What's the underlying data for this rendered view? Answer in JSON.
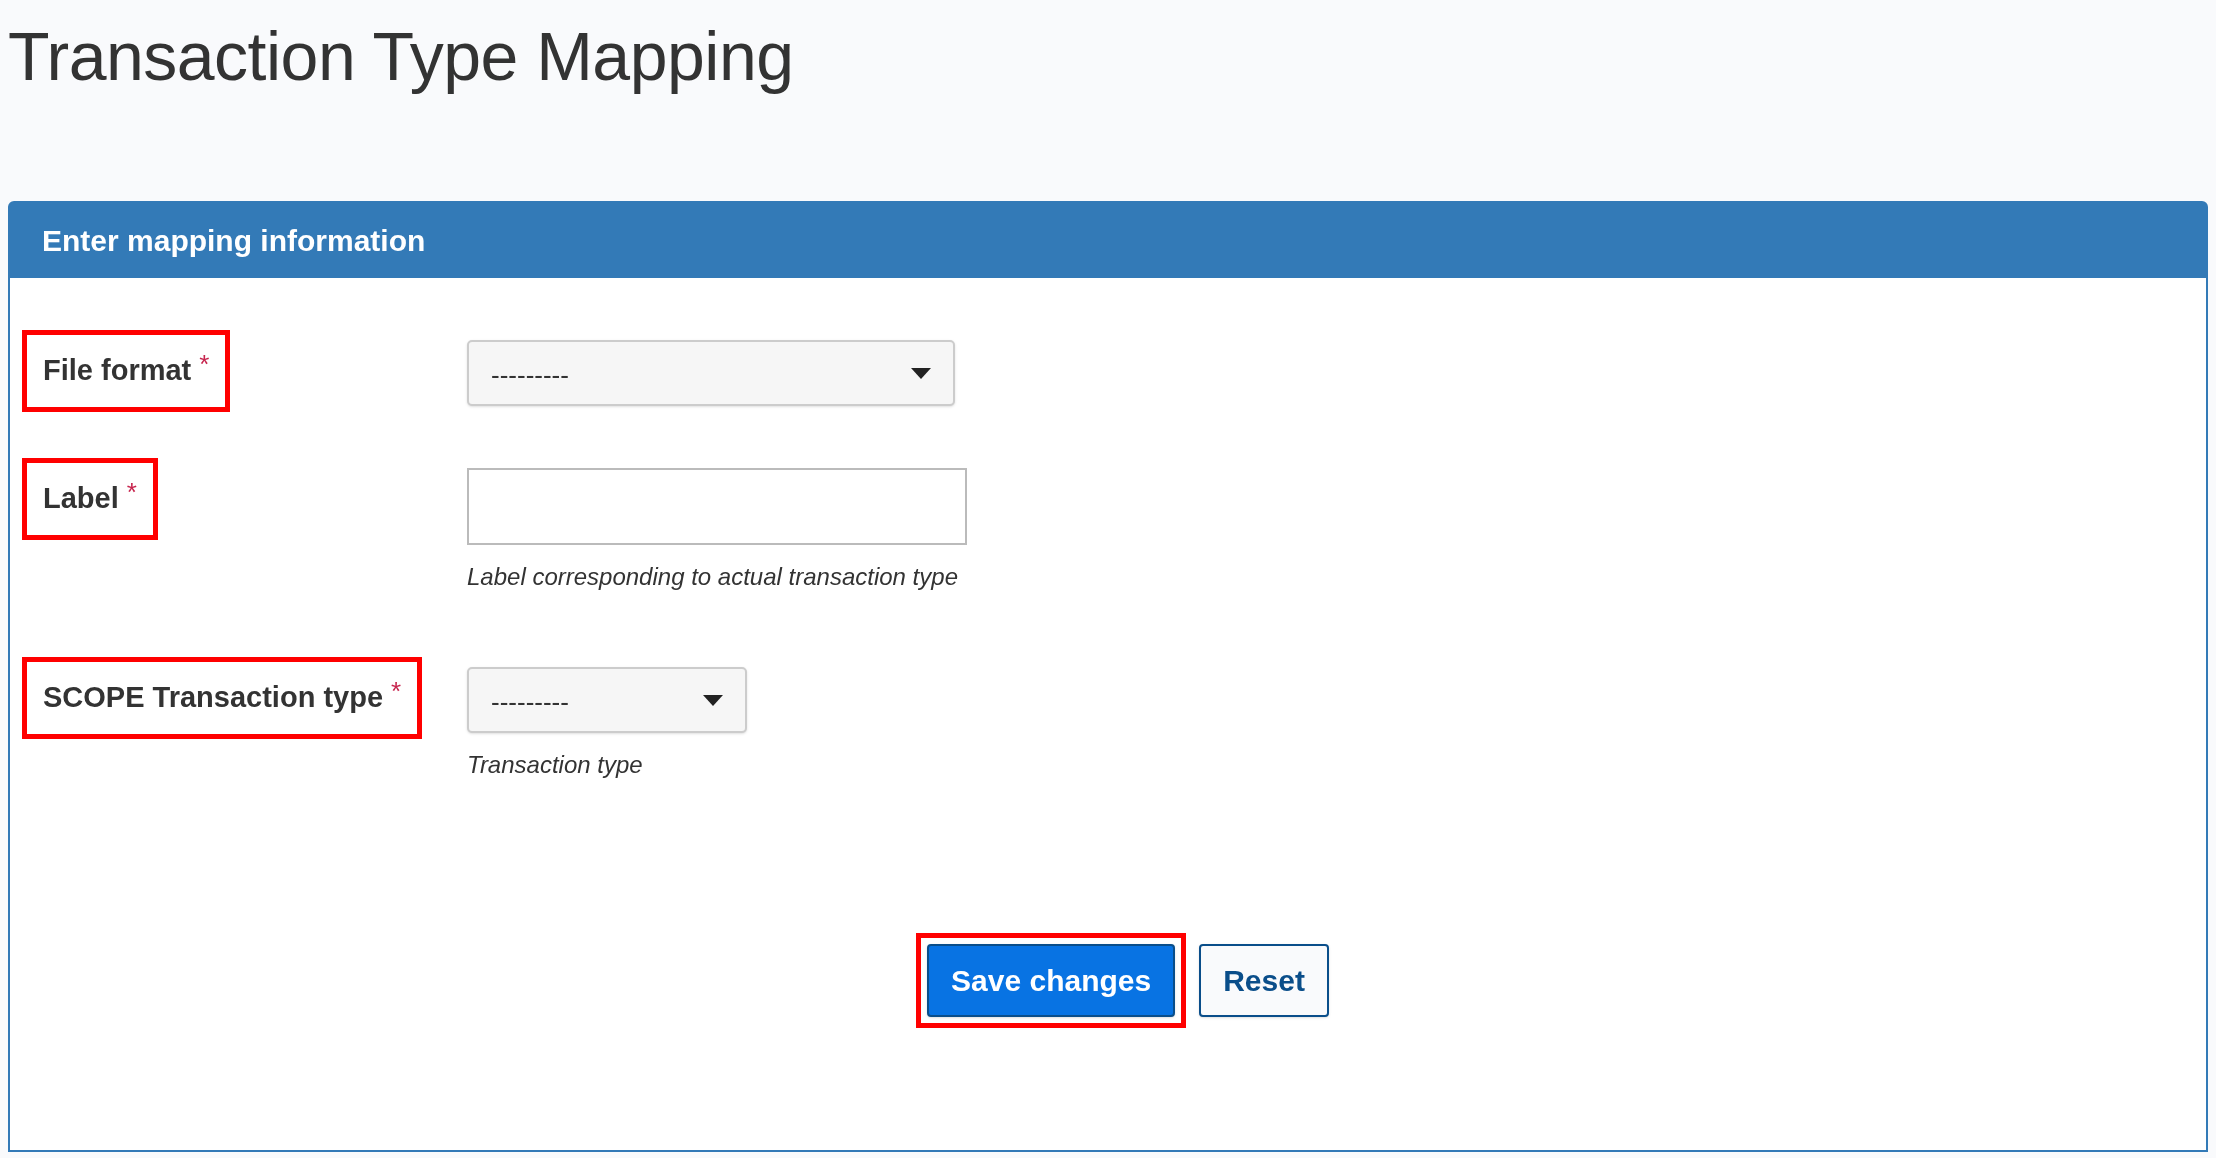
{
  "page_title": "Transaction Type Mapping",
  "panel": {
    "title": "Enter mapping information",
    "fields": [
      {
        "kind": "select",
        "label": "File format",
        "required_mark": "*",
        "highlighted": true,
        "value": "---------"
      },
      {
        "kind": "text",
        "label": "Label",
        "required_mark": "*",
        "highlighted": true,
        "help": "Label corresponding to actual transaction type"
      },
      {
        "kind": "select",
        "label": "SCOPE Transaction type",
        "required_mark": "*",
        "highlighted": true,
        "value": "---------",
        "help": "Transaction type"
      }
    ],
    "buttons": [
      {
        "kind": "primary",
        "label": "Save changes",
        "highlighted": true
      },
      {
        "kind": "secondary",
        "label": "Reset",
        "highlighted": false
      }
    ]
  }
}
